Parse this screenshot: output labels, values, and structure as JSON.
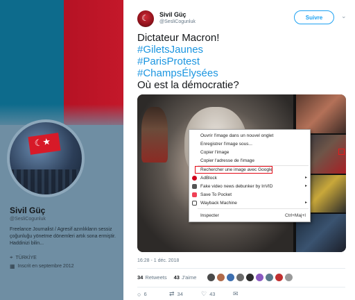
{
  "profile": {
    "name": "Sivil Güç",
    "handle": "@SesliCogunluk",
    "bio": "Freelance Journalist / Agresif azınlıkların sessiz çoğunluğu yönetme dönemleri artık sona ermiştir. Haddinizi bilin...",
    "location": "TÜRKİYE",
    "joined": "Inscrit en septembre 2012"
  },
  "tweet": {
    "author_name": "Sivil Güç",
    "author_handle": "@SesliCogunluk",
    "follow_label": "Suivre",
    "text_line1": "Dictateur Macron!",
    "hashtags": [
      "#GiletsJaunes",
      "#ParisProtest",
      "#ChampsÉlysées"
    ],
    "text_line_last": "Où est la démocratie?",
    "timestamp": "16:28 - 1 déc. 2018",
    "retweets_count": "34",
    "retweets_label": "Retweets",
    "likes_count": "43",
    "likes_label": "J'aime",
    "replies": "6",
    "retweets_action": "34",
    "likes_action": "43"
  },
  "context_menu": {
    "items": [
      {
        "label": "Ouvrir l'image dans un nouvel onglet"
      },
      {
        "label": "Enregistrer l'image sous..."
      },
      {
        "label": "Copier l'image"
      },
      {
        "label": "Copier l'adresse de l'image"
      },
      {
        "label": "Rechercher une image avec Google",
        "highlighted": true
      },
      {
        "label": "AdBlock",
        "icon": "adblock-icon",
        "submenu": true
      },
      {
        "label": "Fake video news debunker by InVID",
        "icon": "invid-icon",
        "submenu": true
      },
      {
        "label": "Save To Pocket",
        "icon": "pocket-icon"
      },
      {
        "label": "Wayback Machine",
        "icon": "wayback-icon",
        "submenu": true
      },
      {
        "label": "Inspecter",
        "shortcut": "Ctrl+Maj+I"
      }
    ]
  },
  "colors": {
    "link": "#1b95e0",
    "follow": "#1da1f2",
    "highlight_border": "#e30613"
  }
}
